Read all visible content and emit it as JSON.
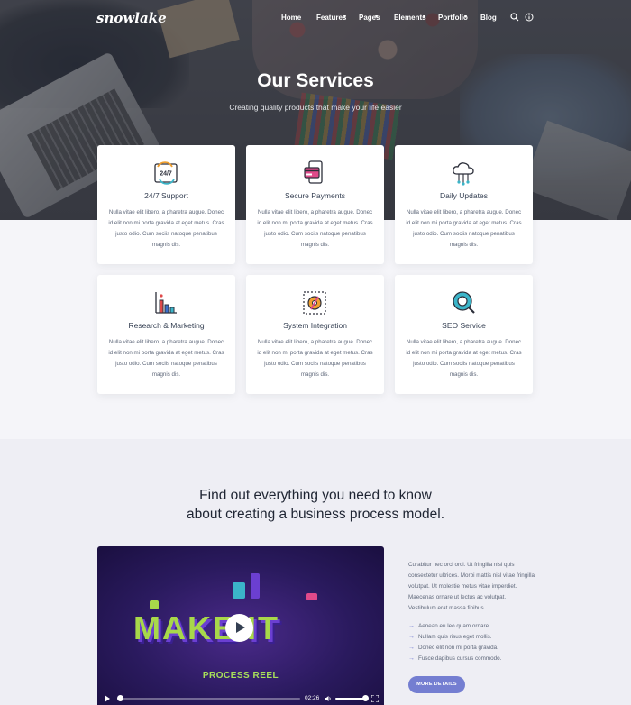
{
  "nav": {
    "logo": "snowlake",
    "items": [
      "Home",
      "Features",
      "Pages",
      "Elements",
      "Portfolio",
      "Blog"
    ]
  },
  "hero": {
    "title": "Our Services",
    "subtitle": "Creating quality products that make your life easier"
  },
  "services": [
    {
      "title": "24/7 Support",
      "icon": "24-7-support-icon",
      "text": "Nulla vitae elit libero, a pharetra augue. Donec id elit non mi porta gravida at eget metus. Cras justo odio. Cum sociis natoque penatibus magnis dis."
    },
    {
      "title": "Secure Payments",
      "icon": "secure-payments-icon",
      "text": "Nulla vitae elit libero, a pharetra augue. Donec id elit non mi porta gravida at eget metus. Cras justo odio. Cum sociis natoque penatibus magnis dis."
    },
    {
      "title": "Daily Updates",
      "icon": "cloud-updates-icon",
      "text": "Nulla vitae elit libero, a pharetra augue. Donec id elit non mi porta gravida at eget metus. Cras justo odio. Cum sociis natoque penatibus magnis dis."
    },
    {
      "title": "Research & Marketing",
      "icon": "bar-chart-icon",
      "text": "Nulla vitae elit libero, a pharetra augue. Donec id elit non mi porta gravida at eget metus. Cras justo odio. Cum sociis natoque penatibus magnis dis."
    },
    {
      "title": "System Integration",
      "icon": "system-integration-icon",
      "text": "Nulla vitae elit libero, a pharetra augue. Donec id elit non mi porta gravida at eget metus. Cras justo odio. Cum sociis natoque penatibus magnis dis."
    },
    {
      "title": "SEO Service",
      "icon": "seo-search-icon",
      "text": "Nulla vitae elit libero, a pharetra augue. Donec id elit non mi porta gravida at eget metus. Cras justo odio. Cum sociis natoque penatibus magnis dis."
    }
  ],
  "process": {
    "title_line1": "Find out everything you need to know",
    "title_line2": "about creating a business process model.",
    "video": {
      "headline": "MAKE IT",
      "caption": "PROCESS REEL",
      "time": "02:26"
    },
    "paragraph": "Curabitur nec orci orci. Ut fringilla nisl quis consectetur ultrices. Morbi mattis nisl vitae fringilla volutpat. Ut molestie metus vitae imperdiet. Maecenas ornare ut lectus ac volutpat. Vestibulum erat massa finibus.",
    "bullets": [
      "Aenean eu leo quam ornare.",
      "Nullam quis risus eget mollis.",
      "Donec elit non mi porta gravida.",
      "Fusce dapibus cursus commodo."
    ],
    "button": "MORE DETAILS"
  },
  "colors": {
    "accent": "#747ed1",
    "heading": "#343f52",
    "body_text": "#60697b",
    "page_bg": "#f5f5f9",
    "section_bg": "#eeeef4"
  }
}
